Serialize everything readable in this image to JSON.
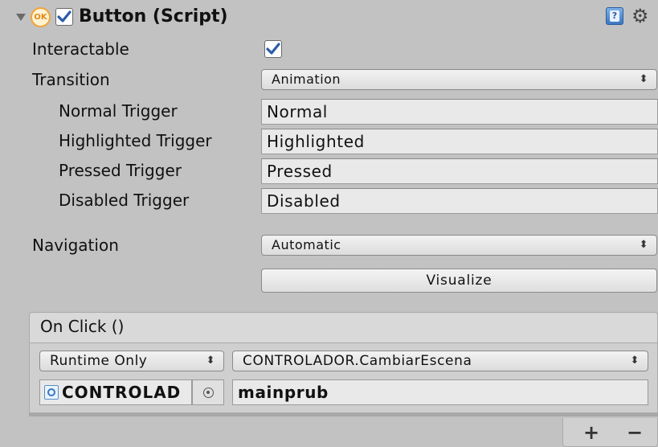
{
  "component": {
    "title": "Button (Script)",
    "ok_icon_text": "OK",
    "enabled": true
  },
  "properties": {
    "interactable_label": "Interactable",
    "interactable_checked": true,
    "transition_label": "Transition",
    "transition_value": "Animation",
    "normal_trigger_label": "Normal Trigger",
    "normal_trigger_value": "Normal",
    "highlighted_trigger_label": "Highlighted Trigger",
    "highlighted_trigger_value": "Highlighted",
    "pressed_trigger_label": "Pressed Trigger",
    "pressed_trigger_value": "Pressed",
    "disabled_trigger_label": "Disabled Trigger",
    "disabled_trigger_value": "Disabled",
    "navigation_label": "Navigation",
    "navigation_value": "Automatic",
    "visualize_label": "Visualize"
  },
  "on_click": {
    "title": "On Click ()",
    "runtime_value": "Runtime Only",
    "method_value": "CONTROLADOR.CambiarEscena",
    "object_value": "CONTROLAD",
    "argument_value": "mainprub",
    "add_label": "+",
    "remove_label": "−"
  },
  "icons": {
    "foldout": "triangle-down-icon",
    "ok": "ok-icon",
    "check": "checkmark-icon",
    "help": "help-book-icon",
    "gear": "gear-icon",
    "popup_arrows": "up-down-arrows-icon",
    "object": "script-object-icon",
    "picker": "object-picker-icon"
  },
  "colors": {
    "background": "#c2c2c2",
    "checkmark": "#2b5ca8",
    "ok_orange": "#f0a63a",
    "help_blue": "#3a77c4"
  }
}
